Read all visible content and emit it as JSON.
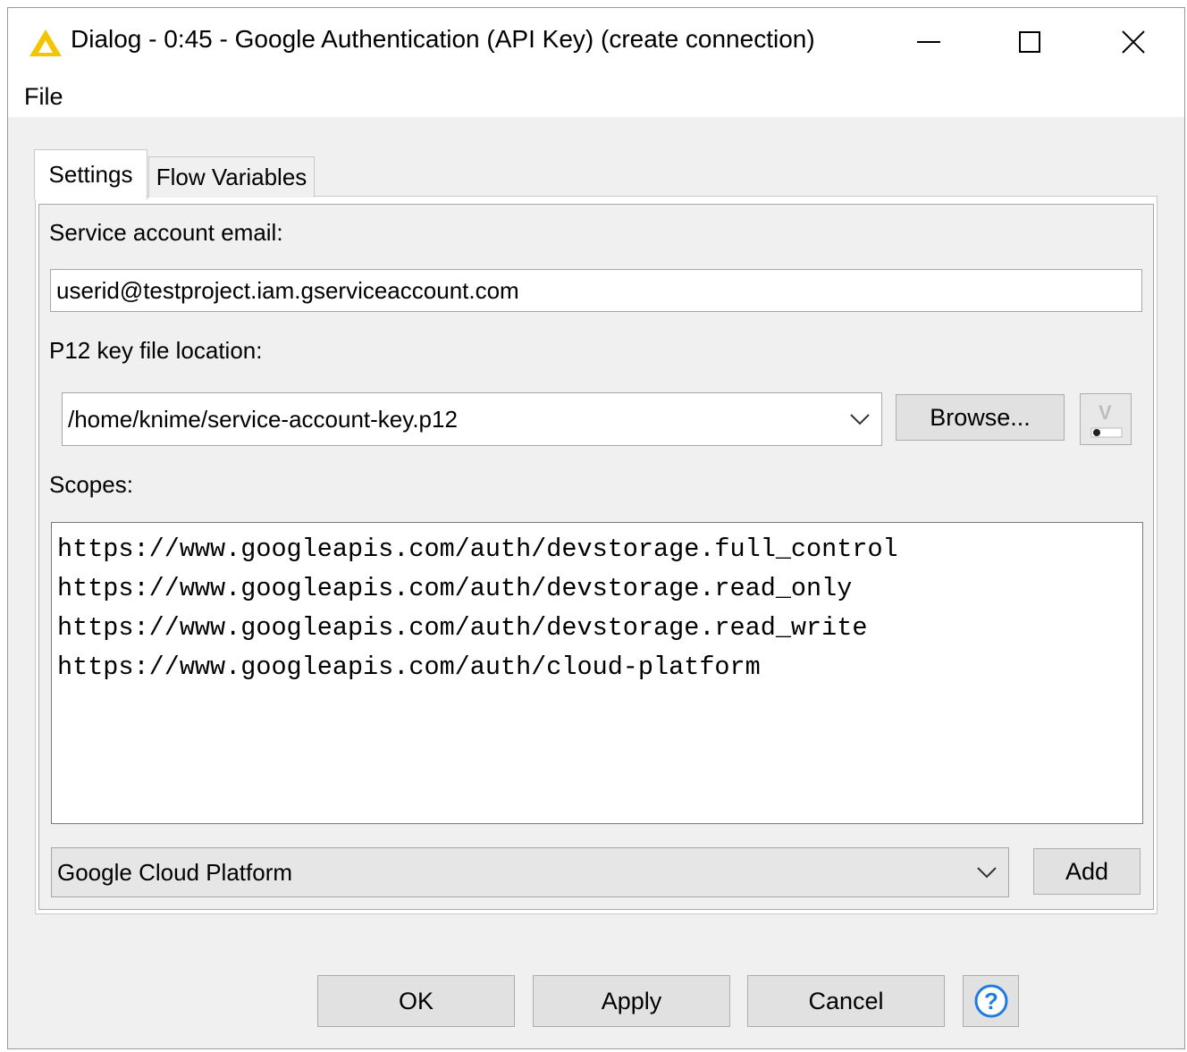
{
  "window": {
    "title": "Dialog - 0:45 - Google Authentication (API Key) (create connection)",
    "icon": "knime-warning-triangle-icon"
  },
  "menu": {
    "file": "File"
  },
  "tabs": [
    {
      "label": "Settings",
      "active": true
    },
    {
      "label": "Flow Variables",
      "active": false
    }
  ],
  "settings": {
    "email_label": "Service account email:",
    "email_value": "userid@testproject.iam.gserviceaccount.com",
    "keyfile_label": "P12 key file location:",
    "keyfile_value": "/home/knime/service-account-key.p12",
    "browse_label": "Browse...",
    "scopes_label": "Scopes:",
    "scopes": [
      "https://www.googleapis.com/auth/devstorage.full_control",
      "https://www.googleapis.com/auth/devstorage.read_only",
      "https://www.googleapis.com/auth/devstorage.read_write",
      "https://www.googleapis.com/auth/cloud-platform"
    ],
    "scope_select_value": "Google Cloud Platform",
    "add_label": "Add"
  },
  "buttons": {
    "ok": "OK",
    "apply": "Apply",
    "cancel": "Cancel"
  },
  "colors": {
    "accent_yellow": "#f5c400",
    "help_blue": "#1e7be0",
    "dialog_bg": "#f0f0f0"
  }
}
